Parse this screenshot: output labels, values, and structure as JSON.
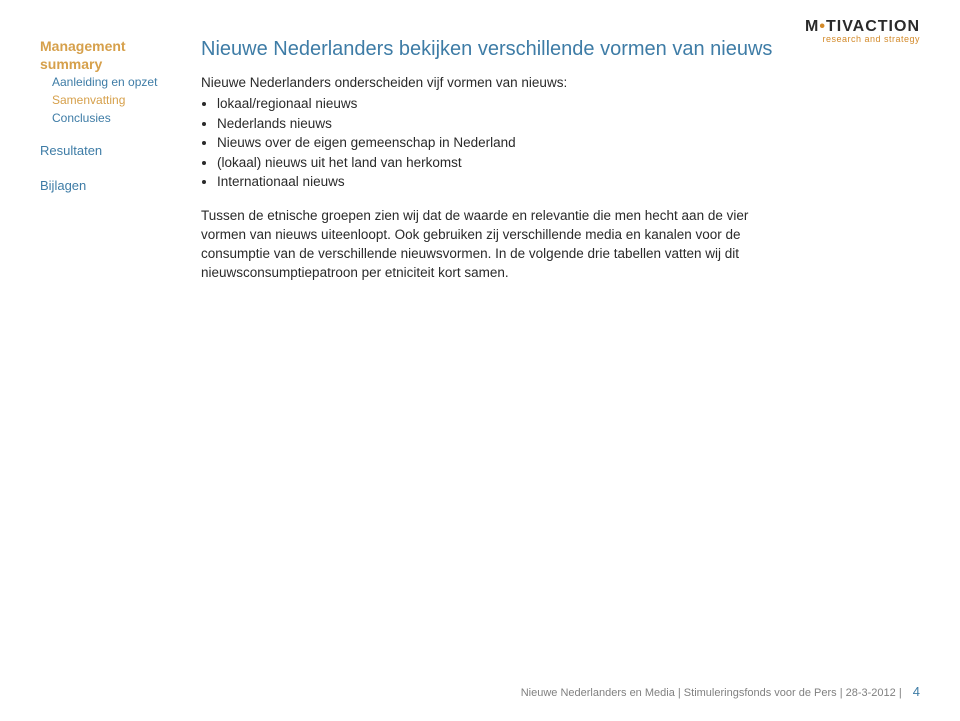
{
  "logo": {
    "line1_a": "M",
    "line1_b": "TIVACTION",
    "line2": "research and strategy"
  },
  "sidebar": {
    "mgmt": {
      "heading_l1": "Management",
      "heading_l2": "summary",
      "sub_items": [
        {
          "label": "Aanleiding en opzet",
          "active": false
        },
        {
          "label": "Samenvatting",
          "active": true
        },
        {
          "label": "Conclusies",
          "active": false
        }
      ]
    },
    "links": [
      {
        "label": "Resultaten"
      },
      {
        "label": "Bijlagen"
      }
    ]
  },
  "main": {
    "title": "Nieuwe Nederlanders bekijken verschillende vormen van nieuws",
    "subtitle": "Nieuwe Nederlanders onderscheiden vijf vormen van nieuws:",
    "bullets": [
      "lokaal/regionaal nieuws",
      "Nederlands nieuws",
      "Nieuws over de eigen gemeenschap in Nederland",
      "(lokaal) nieuws uit het land van herkomst",
      "Internationaal nieuws"
    ],
    "paragraph": "Tussen de etnische groepen zien wij dat de waarde en relevantie die men hecht aan de vier vormen van nieuws uiteenloopt. Ook gebruiken zij verschillende media en kanalen voor de consumptie van de verschillende nieuwsvormen. In de volgende drie tabellen vatten wij dit nieuwsconsumptiepatroon per etniciteit kort samen."
  },
  "footer": {
    "left": "Nieuwe Nederlanders en Media |",
    "mid": "Stimuleringsfonds voor de Pers",
    "date": "| 28-3-2012 |",
    "page": "4"
  }
}
